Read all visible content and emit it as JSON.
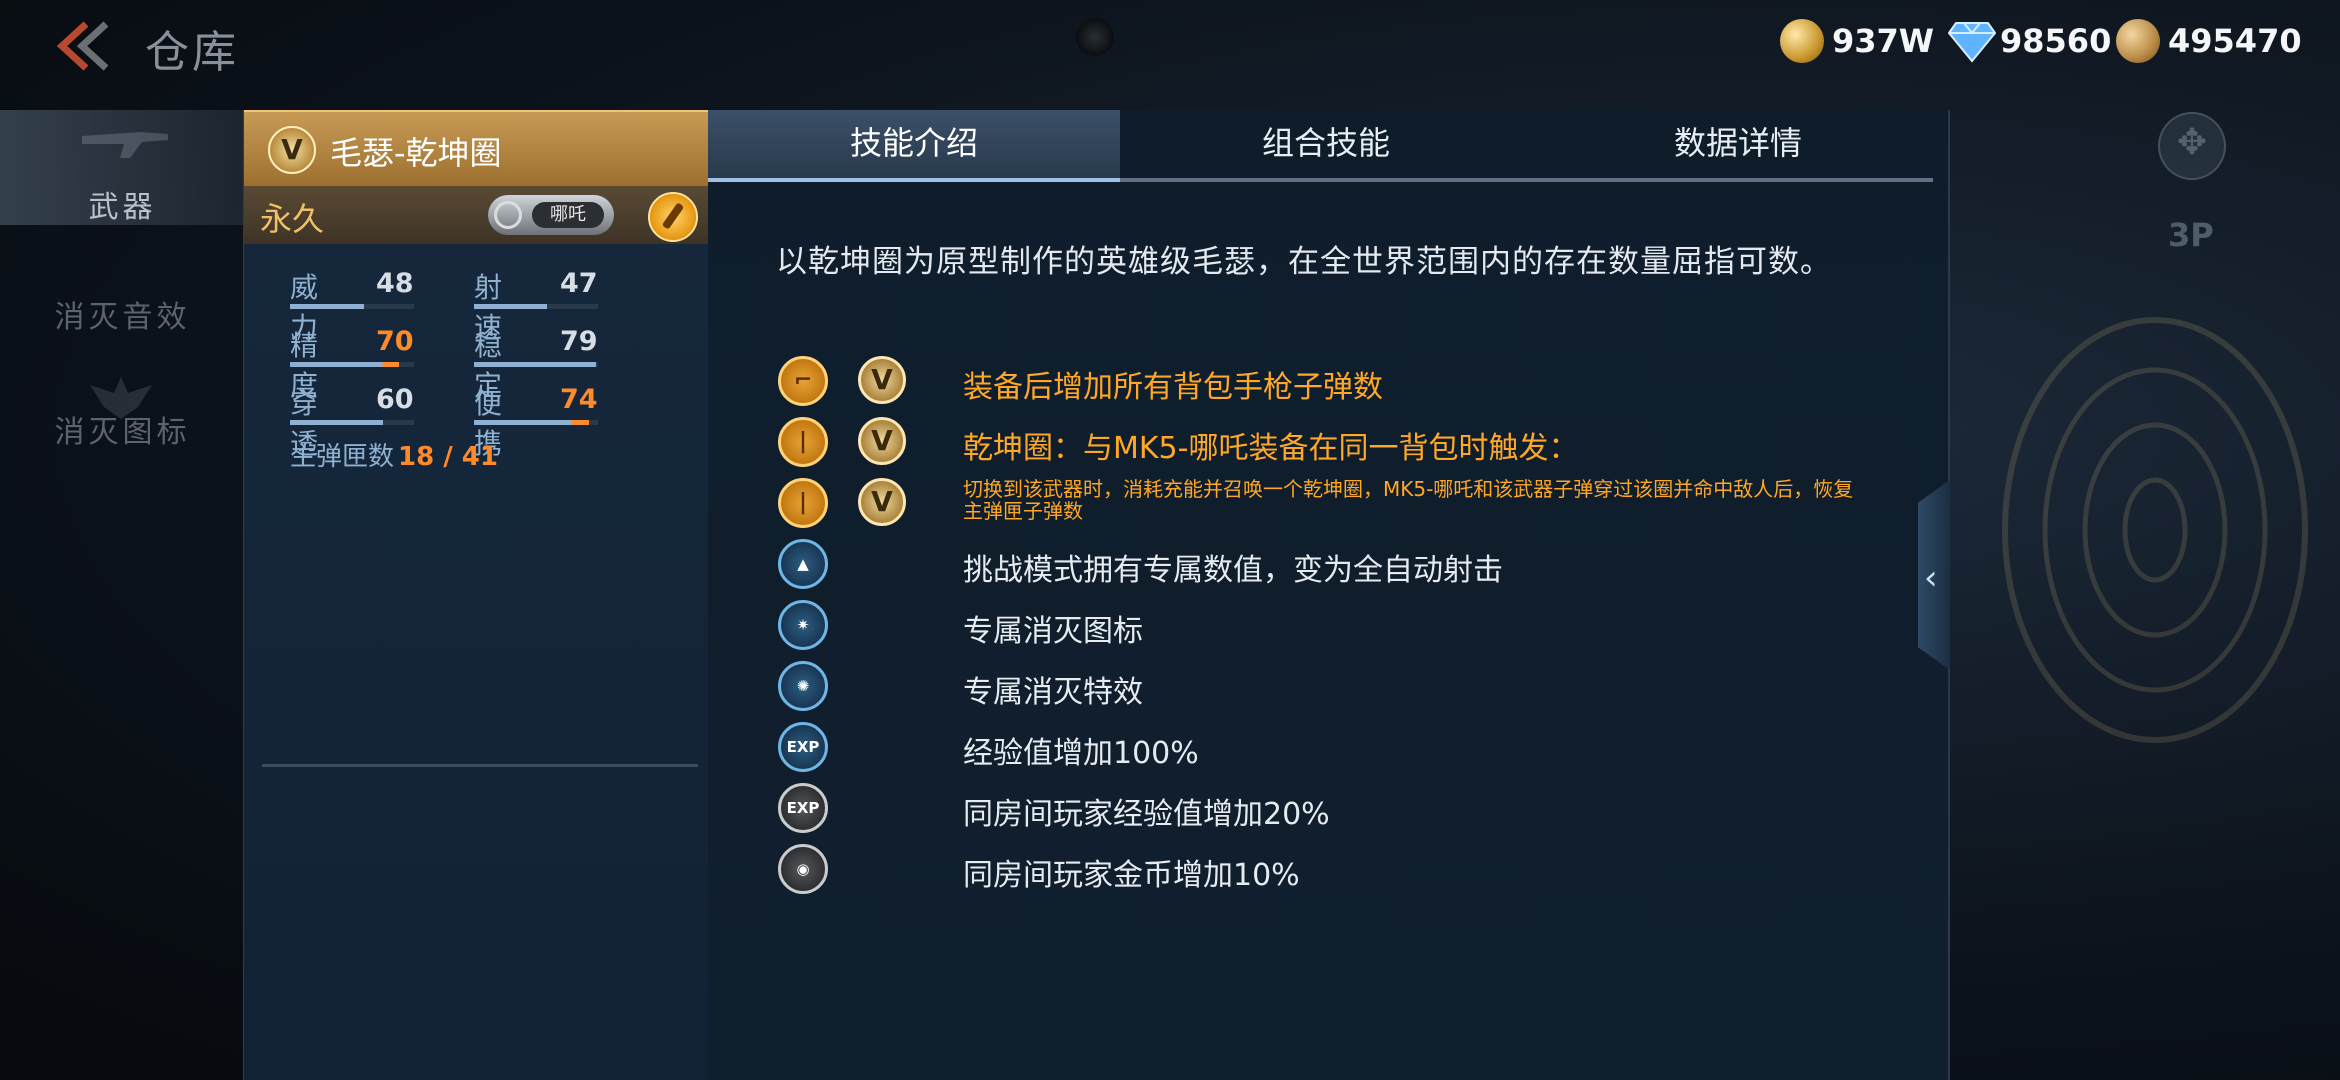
{
  "header": {
    "title": "仓库",
    "currencies": [
      {
        "icon": "gold-coin-icon",
        "value": "937W"
      },
      {
        "icon": "diamond-icon",
        "value": "98560"
      },
      {
        "icon": "honor-token-icon",
        "value": "495470"
      }
    ]
  },
  "sidebar": {
    "items": [
      {
        "label": "武器",
        "active": true
      },
      {
        "label": "消灭音效",
        "active": false
      },
      {
        "label": "消灭图标",
        "active": false
      }
    ]
  },
  "item": {
    "badge": "V",
    "name": "毛瑟-乾坤圈",
    "duration": "永久",
    "partner_label": "哪吒",
    "stats": [
      {
        "name": "威力",
        "value": "48",
        "highlight": false,
        "level": 0.48
      },
      {
        "name": "射速",
        "value": "47",
        "highlight": false,
        "level": 0.47
      },
      {
        "name": "精度",
        "value": "70",
        "highlight": true,
        "level": 0.7
      },
      {
        "name": "稳定",
        "value": "79",
        "highlight": false,
        "level": 0.79
      },
      {
        "name": "穿透",
        "value": "60",
        "highlight": false,
        "level": 0.6
      },
      {
        "name": "便携",
        "value": "74",
        "highlight": true,
        "level": 0.74
      }
    ],
    "ammo_label": "主弹匣数",
    "ammo_value": "18 / 41"
  },
  "tabs": [
    {
      "label": "技能介绍",
      "active": true
    },
    {
      "label": "组合技能",
      "active": false
    },
    {
      "label": "数据详情",
      "active": false
    }
  ],
  "description": "以乾坤圈为原型制作的英雄级毛瑟，在全世界范围内的存在数量屈指可数。",
  "skills": [
    {
      "icon": "pistol-icon",
      "style": "gold",
      "v_badge": "V",
      "text": "装备后增加所有背包手枪子弹数",
      "color": "orange"
    },
    {
      "icon": "bullet-icon",
      "style": "gold",
      "v_badge": "V",
      "text": "乾坤圈：与MK5-哪吒装备在同一背包时触发：",
      "color": "orange"
    },
    {
      "icon": "bullet-icon",
      "style": "gold",
      "v_badge": "V",
      "text": "切换到该武器时，消耗充能并召唤一个乾坤圈，MK5-哪吒和该武器子弹穿过该圈并命中敌人后，恢复主弹匣子弹数",
      "color": "orange-small"
    },
    {
      "icon": "challenge-mode-icon",
      "style": "blue",
      "v_badge": "",
      "text": "挑战模式拥有专属数值，变为全自动射击",
      "color": "white"
    },
    {
      "icon": "kill-icon-icon",
      "style": "blue",
      "v_badge": "",
      "text": "专属消灭图标",
      "color": "white"
    },
    {
      "icon": "kill-effect-icon",
      "style": "blue",
      "v_badge": "",
      "text": "专属消灭特效",
      "color": "white"
    },
    {
      "icon": "exp-icon",
      "style": "blue",
      "v_badge": "",
      "text": "经验值增加100%",
      "color": "white"
    },
    {
      "icon": "room-exp-icon",
      "style": "grey",
      "v_badge": "",
      "text": "同房间玩家经验值增加20%",
      "color": "white"
    },
    {
      "icon": "room-gold-icon",
      "style": "grey",
      "v_badge": "",
      "text": "同房间玩家金币增加10%",
      "color": "white"
    }
  ],
  "scene": {
    "view_mode": "3P"
  }
}
